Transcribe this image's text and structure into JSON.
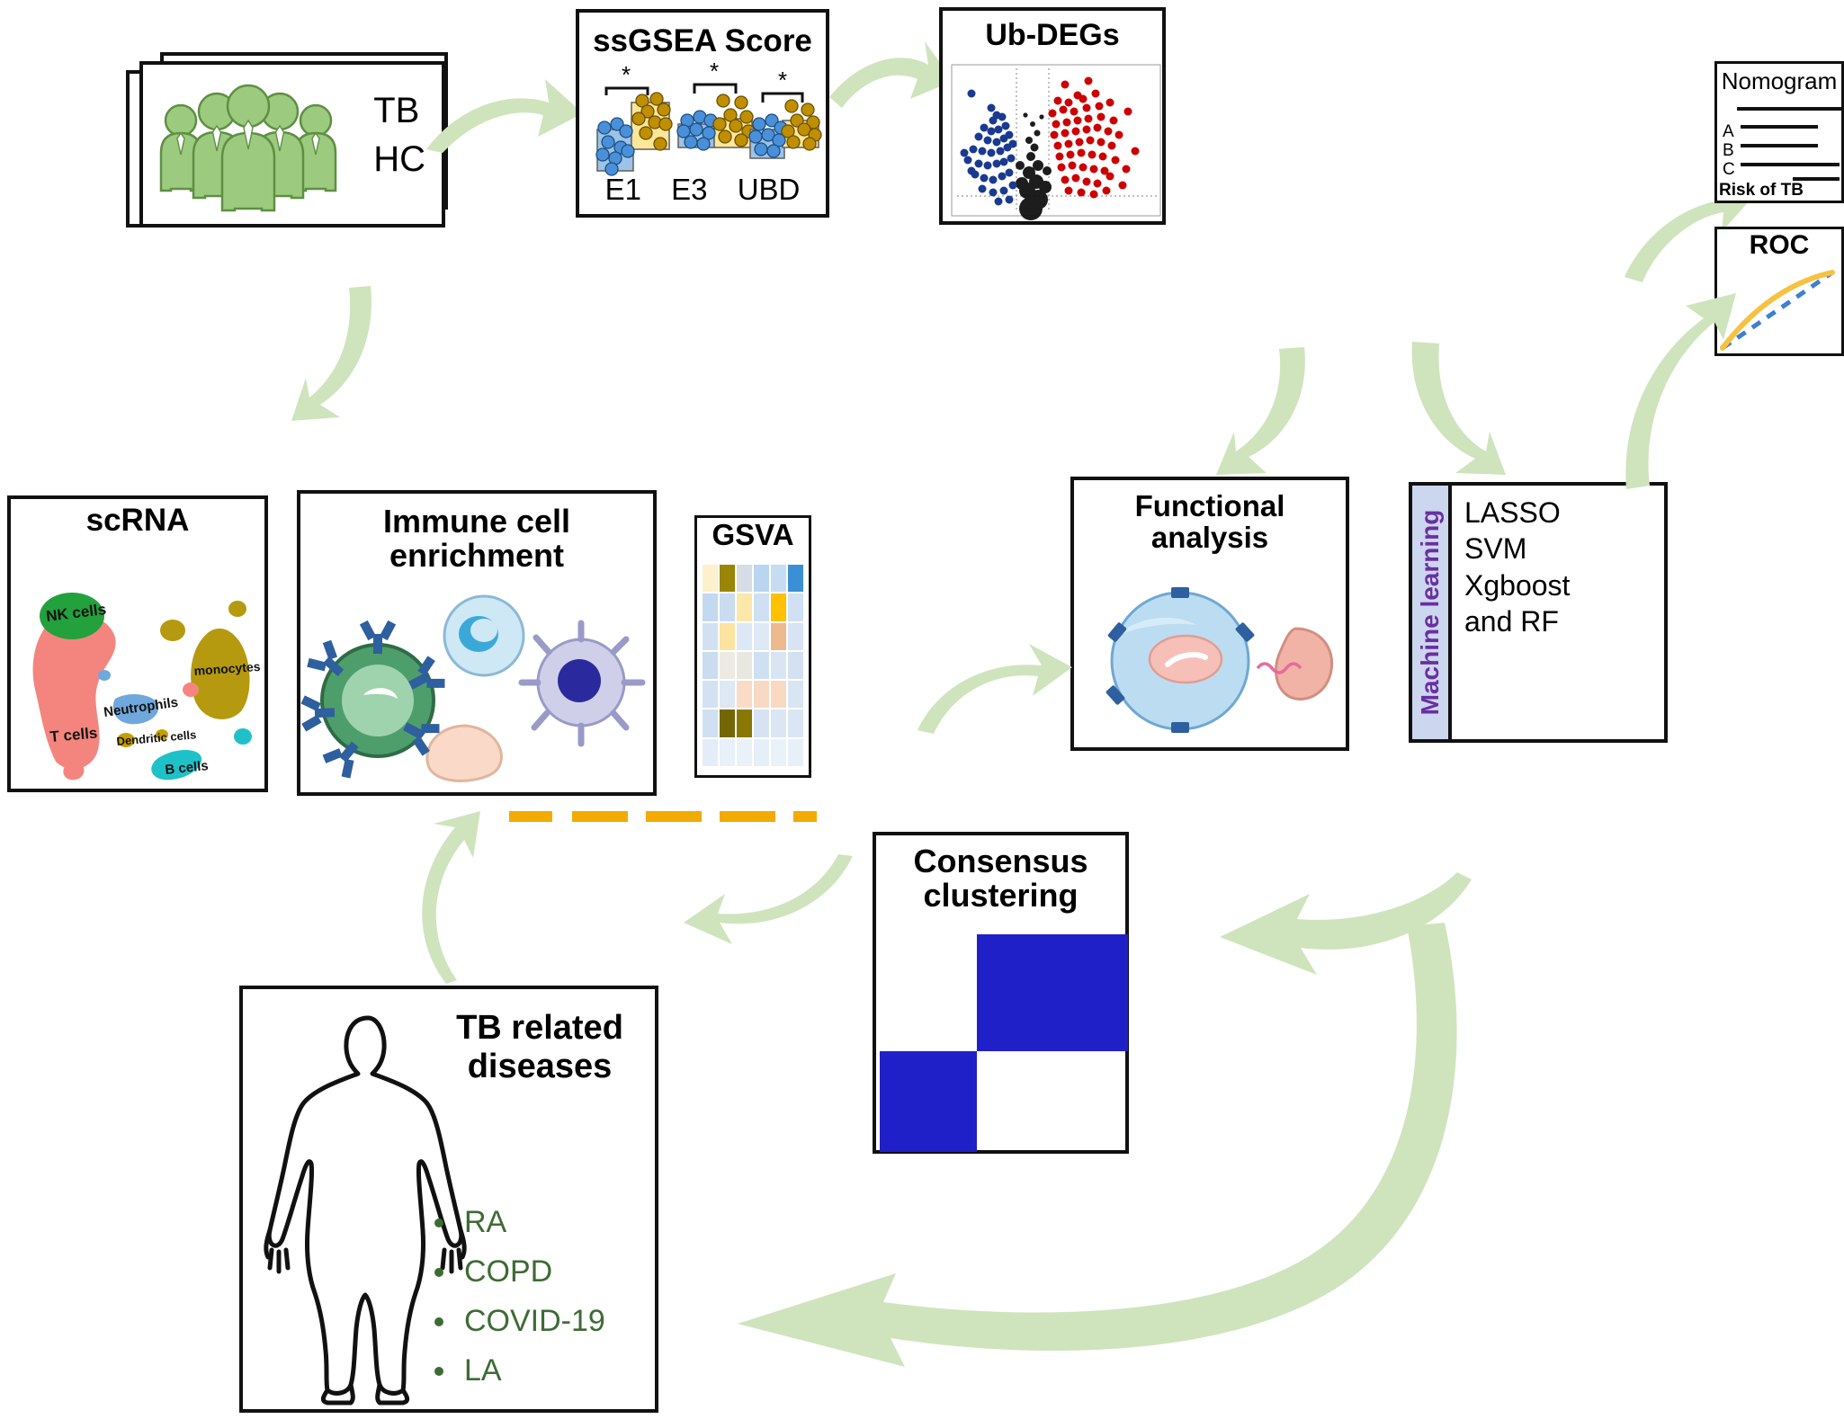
{
  "cohort": {
    "labels": [
      "TB",
      "HC"
    ],
    "icon": "people-group-icon"
  },
  "ssgsea": {
    "title": "ssGSEA Score",
    "significance_marks": [
      "*",
      "*",
      "*"
    ],
    "categories": [
      "E1",
      "E3",
      "UBD"
    ],
    "group_colors": {
      "control": "#9dc3e6",
      "case": "#ffe699"
    },
    "point_colors": {
      "control": "#4a90d9",
      "case": "#bf8f00"
    }
  },
  "volcano": {
    "title": "Ub-DEGs",
    "colors": {
      "down": "#1a3a8f",
      "up": "#cc0000",
      "ns": "#111111"
    }
  },
  "nomogram": {
    "title": "Nomogram",
    "rows": [
      "A",
      "B",
      "C"
    ],
    "risk_label": "Risk of TB"
  },
  "roc": {
    "title": "ROC",
    "curve_color": "#f5c242",
    "reference_color": "#3d7fd0"
  },
  "scrna": {
    "title": "scRNA",
    "clusters": [
      {
        "label": "NK cells",
        "color": "#22a13c"
      },
      {
        "label": "T cells",
        "color": "#f4857e"
      },
      {
        "label": "Neutrophils",
        "color": "#6fa8dc"
      },
      {
        "label": "monocytes",
        "color": "#b59a10"
      },
      {
        "label": "Dendritic cells",
        "color": "#c4a000"
      },
      {
        "label": "B cells",
        "color": "#1fc1c8"
      }
    ]
  },
  "immune": {
    "title": "Immune cell enrichment"
  },
  "gsva": {
    "title": "GSVA",
    "heatmap": {
      "rows": 7,
      "cols": 6,
      "cells": [
        [
          "#fdf0cd",
          "#9a8506",
          "#d6dde4",
          "#b9d5ef",
          "#c6dcf2",
          "#3b8fd4"
        ],
        [
          "#c3d9ef",
          "#c9dcf0",
          "#fbe8a8",
          "#cfe0f2",
          "#ffc000",
          "#cfe1f2"
        ],
        [
          "#d2e1f2",
          "#fde3a0",
          "#dce8f5",
          "#dfe9f5",
          "#edb98f",
          "#d8e4f3"
        ],
        [
          "#c9dcf0",
          "#eceae2",
          "#e8e8e0",
          "#cfe0f2",
          "#d9e5f3",
          "#d4e1f2"
        ],
        [
          "#d3e1f2",
          "#dde8f4",
          "#f9dbc6",
          "#f8d9c3",
          "#f9d9c2",
          "#d9e5f3"
        ],
        [
          "#cfe0f2",
          "#756604",
          "#897806",
          "#d7e3f3",
          "#dbe6f4",
          "#dbe6f4"
        ],
        [
          "#e4edf7",
          "#e8f0f9",
          "#eaf1f9",
          "#e6eff8",
          "#e9f1f9",
          "#e7f0f8"
        ]
      ]
    }
  },
  "functional": {
    "title": "Functional analysis"
  },
  "machine_learning": {
    "side_label": "Machine learning",
    "methods": [
      "LASSO",
      "SVM",
      "Xgboost",
      "and RF"
    ],
    "side_bg": "#ccd6ef",
    "side_text_color": "#6a2fa0"
  },
  "consensus": {
    "title": "Consensus clustering",
    "block_color": "#2020c8"
  },
  "tb_diseases": {
    "title": "TB related diseases",
    "items": [
      "RA",
      "COPD",
      "COVID-19",
      "LA"
    ],
    "text_color": "#3e6b34",
    "icon": "human-body-silhouette-icon"
  },
  "connectors": {
    "arrow_color": "#cfe4bd",
    "dash_color": "#f2ab00"
  }
}
